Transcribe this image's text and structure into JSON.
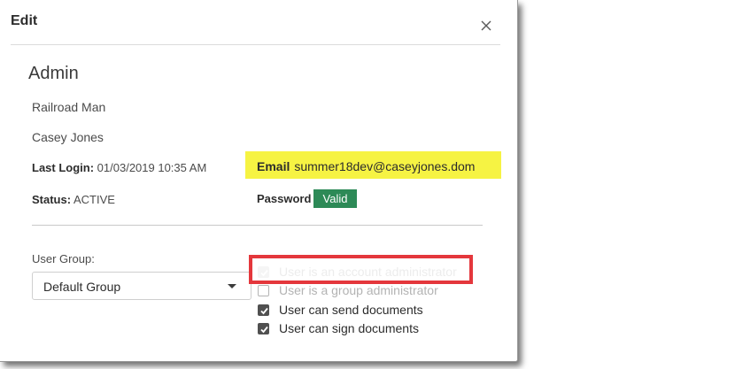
{
  "dialog": {
    "title": "Edit",
    "close_icon": "close-icon"
  },
  "profile": {
    "section_title": "Admin",
    "company": "Railroad Man",
    "name": "Casey Jones",
    "last_login_label": "Last Login:",
    "last_login_value": "01/03/2019 10:35 AM",
    "status_label": "Status:",
    "status_value": "ACTIVE",
    "email_label": "Email",
    "email_value": "summer18dev@caseyjones.dom",
    "password_label": "Password",
    "password_badge": "Valid"
  },
  "group": {
    "label": "User Group:",
    "selected": "Default Group"
  },
  "permissions": [
    {
      "label": "User is an account administrator",
      "checked": true,
      "disabled": true
    },
    {
      "label": "User is a group administrator",
      "checked": false,
      "disabled": true
    },
    {
      "label": "User can send documents",
      "checked": true,
      "disabled": false
    },
    {
      "label": "User can sign documents",
      "checked": true,
      "disabled": false
    }
  ],
  "colors": {
    "highlight": "#f6f343",
    "badge_green": "#2d8a57",
    "annotation_red": "#e4373c"
  }
}
